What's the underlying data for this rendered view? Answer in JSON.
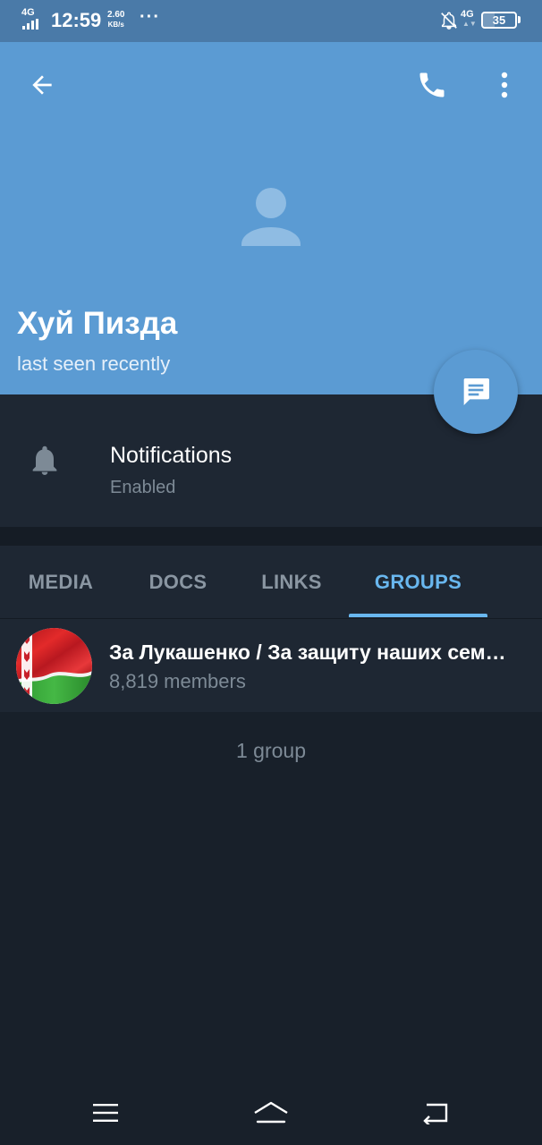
{
  "status_bar": {
    "network_left": "4G",
    "time": "12:59",
    "speed_value": "2.60",
    "speed_unit": "KB/s",
    "dots": "···",
    "network_right": "4G",
    "battery_level": "35"
  },
  "header": {
    "name": "Хуй Пизда",
    "status": "last seen recently",
    "background_color": "#5b9bd3"
  },
  "notifications": {
    "title": "Notifications",
    "value": "Enabled"
  },
  "tabs": [
    {
      "label": "MEDIA",
      "active": false
    },
    {
      "label": "DOCS",
      "active": false
    },
    {
      "label": "LINKS",
      "active": false
    },
    {
      "label": "GROUPS",
      "active": true
    }
  ],
  "groups": [
    {
      "name": "За Лукашенко / За защиту наших сем…",
      "members": "8,819 members"
    }
  ],
  "group_count": "1 group",
  "icons": {
    "back": "arrow-left-icon",
    "call": "phone-icon",
    "more": "more-vert-icon",
    "fab": "message-icon",
    "notifications": "bell-icon"
  },
  "colors": {
    "accent": "#69b7ef",
    "surface": "#1e2733",
    "background": "#18202a"
  }
}
